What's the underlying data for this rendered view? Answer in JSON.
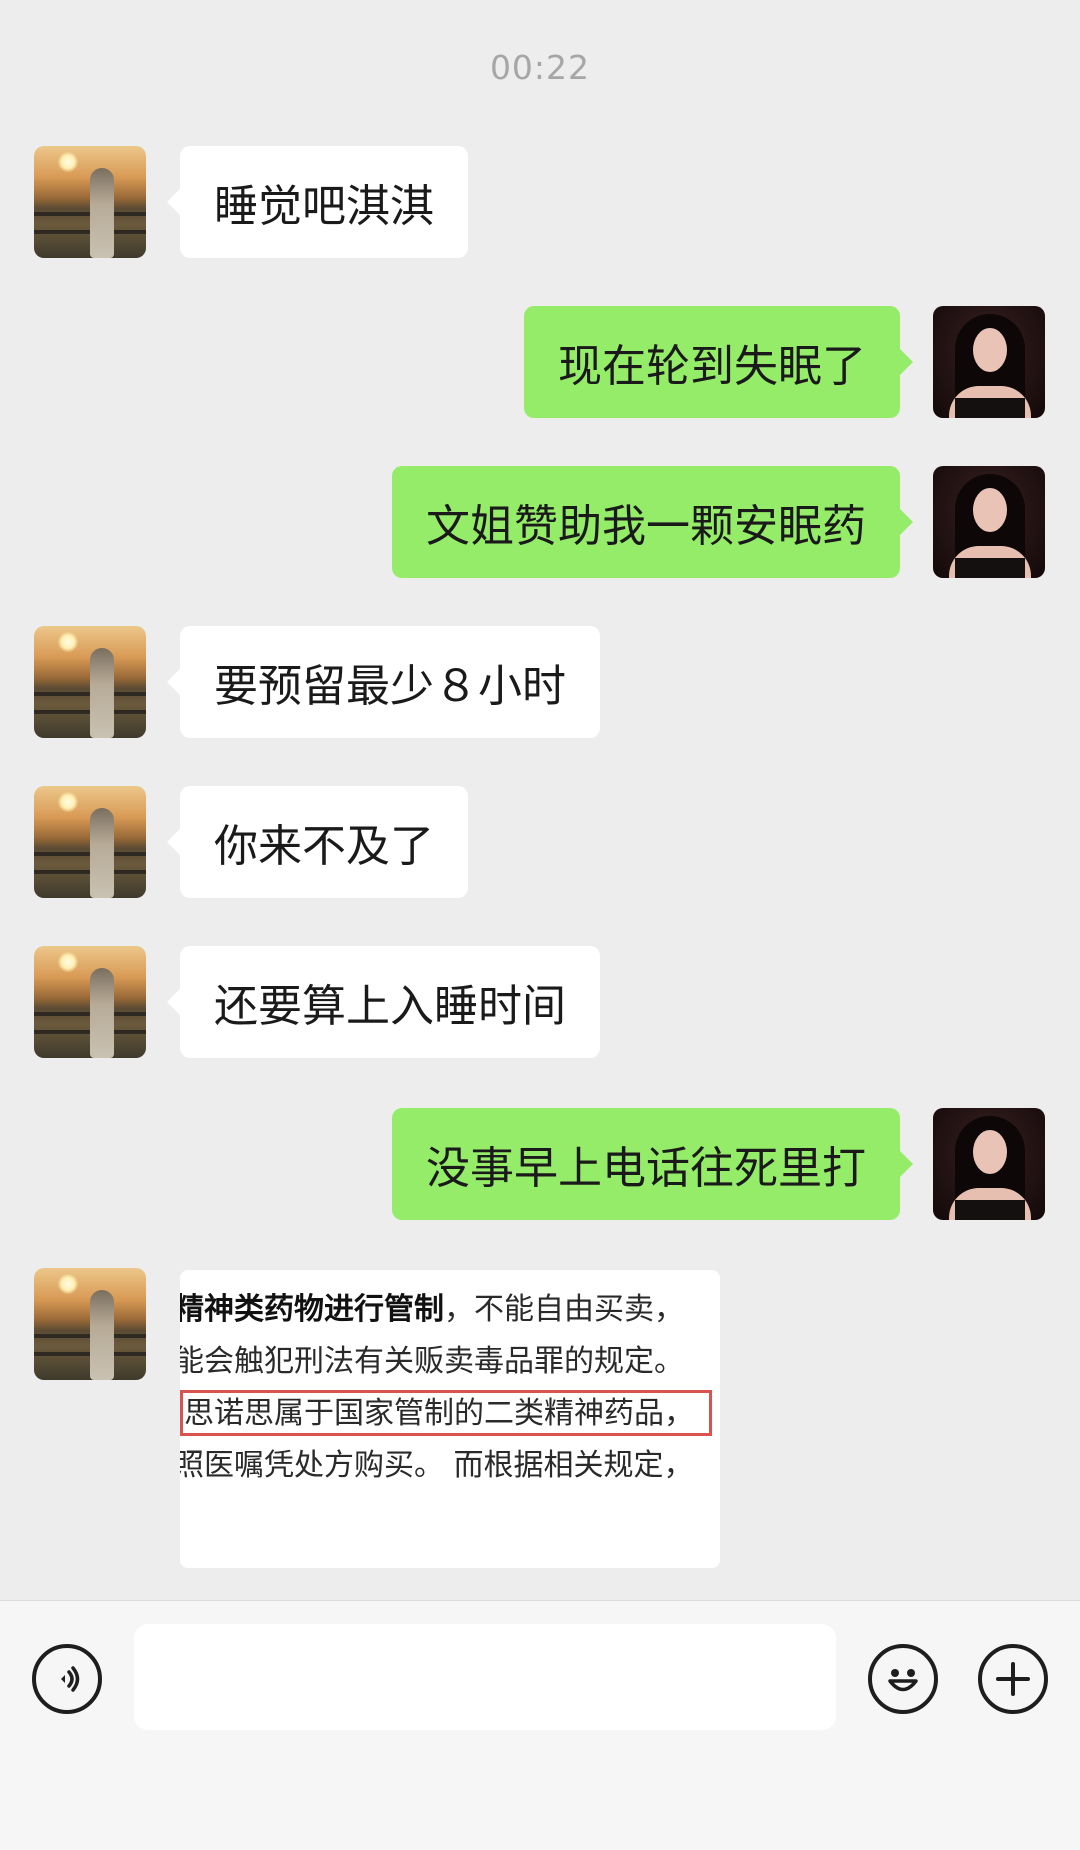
{
  "timestamp": "00:22",
  "messages": [
    {
      "side": "left",
      "text": "睡觉吧淇淇"
    },
    {
      "side": "right",
      "text": "现在轮到失眠了"
    },
    {
      "side": "right",
      "text": "文姐赞助我一颗安眠药"
    },
    {
      "side": "left",
      "text": "要预留最少８小时"
    },
    {
      "side": "left",
      "text": "你来不及了"
    },
    {
      "side": "left",
      "text": "还要算上入睡时间"
    },
    {
      "side": "right",
      "text": "没事早上电话往死里打"
    }
  ],
  "image_message": {
    "line1_bold": "精神类药物进行管制",
    "line1_rest": "，不能自由买卖，",
    "line2": "能会触犯刑法有关贩卖毒品罪的规定。",
    "line3": "思诺思属于国家管制的二类精神药品，",
    "line4": "照医嘱凭处方购买。 而根据相关规定，"
  },
  "input_bar": {
    "voice_icon": "voice-icon",
    "emoji_icon": "emoji-icon",
    "plus_icon": "plus-icon",
    "input_value": ""
  }
}
